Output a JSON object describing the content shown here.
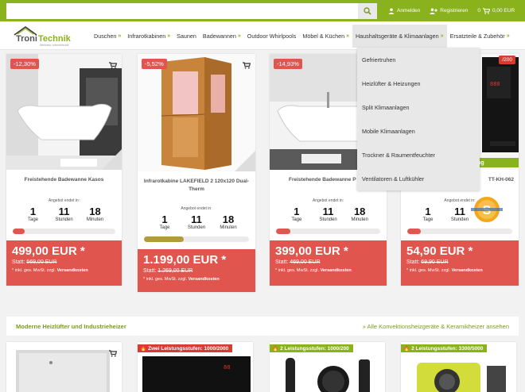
{
  "search": {
    "placeholder": ""
  },
  "topbar": {
    "login": "Anmelden",
    "register": "Registrieren",
    "cart_count": "0",
    "cart_total": "0,00 EUR"
  },
  "logo": {
    "text": "TroniTechnik",
    "tagline": "Wellness Lebensfreude"
  },
  "nav": [
    {
      "label": "Duschen"
    },
    {
      "label": "Infrarotkabinen"
    },
    {
      "label": "Saunen"
    },
    {
      "label": "Badewannen"
    },
    {
      "label": "Outdoor Whirlpools"
    },
    {
      "label": "Möbel & Küchen"
    },
    {
      "label": "Haushaltsgeräte & Klimaanlagen"
    },
    {
      "label": "Ersatzteile & Zubehör"
    }
  ],
  "dropdown": [
    {
      "label": "Gefriertruhen"
    },
    {
      "label": "Heizlüfter & Heizungen"
    },
    {
      "label": "Split Klimaanlagen"
    },
    {
      "label": "Mobile Klimaanlagen"
    },
    {
      "label": "Trockner & Raumentfeuchter"
    },
    {
      "label": "Ventilatoren & Luftkühler"
    }
  ],
  "countdown_labels": {
    "offer_ends": "Angebot endet in:",
    "days": "Tage",
    "hours": "Stunden",
    "minutes": "Minuten"
  },
  "products": [
    {
      "discount": "-12,30%",
      "title": "Freistehende Badewanne Kasos",
      "days": "1",
      "hours": "11",
      "minutes": "18",
      "progress": 0.12,
      "bar_color": "#e0554d",
      "price": "499,00 EUR *",
      "old_label": "Statt:",
      "old_price": "569,00 EUR",
      "note_prefix": "* inkl. ges. MwSt. zzgl.",
      "note_link": "Versandkosten"
    },
    {
      "discount": "-5,52%",
      "title": "Infrarotkabine LAKEFIELD 2 120x120 Dual-Therm",
      "days": "1",
      "hours": "11",
      "minutes": "18",
      "progress": 0.38,
      "bar_color": "#b39a3a",
      "price": "1.199,00 EUR *",
      "old_label": "Statt:",
      "old_price": "1.269,00 EUR",
      "note_prefix": "* inkl. ges. MwSt. zzgl.",
      "note_link": "Versandkosten"
    },
    {
      "discount": "-14,93%",
      "title": "Freistehende Badewanne P",
      "days": "1",
      "hours": "11",
      "minutes": "18",
      "progress": 0.14,
      "bar_color": "#e0554d",
      "price": "399,00 EUR *",
      "old_label": "Statt:",
      "old_price": "469,00 EUR",
      "note_prefix": "* inkl. ges. MwSt. zzgl.",
      "note_link": "Versandkosten"
    },
    {
      "discount": "/200",
      "title": "TT-KH-062",
      "days": "1",
      "hours": "11",
      "minutes": "",
      "progress": 0.13,
      "bar_color": "#e0554d",
      "price": "54,90 EUR *",
      "old_label": "Statt:",
      "old_price": "69,90 EUR",
      "note_prefix": "* inkl. ges. MwSt. zzgl.",
      "note_link": "Versandkosten",
      "strip": "nbedienung"
    }
  ],
  "section": {
    "title": "Moderne Heizlüfter und Industrieheizer",
    "link": "» Alle Konvektionsheizgeräte & Keramikheizer ansehen"
  },
  "bottom": [
    {
      "ribbon": ""
    },
    {
      "ribbon": "Zwei Leistungsstufen: 1000/2000"
    },
    {
      "ribbon": "2 Leistungsstufen: 1000/200"
    },
    {
      "ribbon": "2 Leistungsstufen: 3300/5000"
    }
  ]
}
